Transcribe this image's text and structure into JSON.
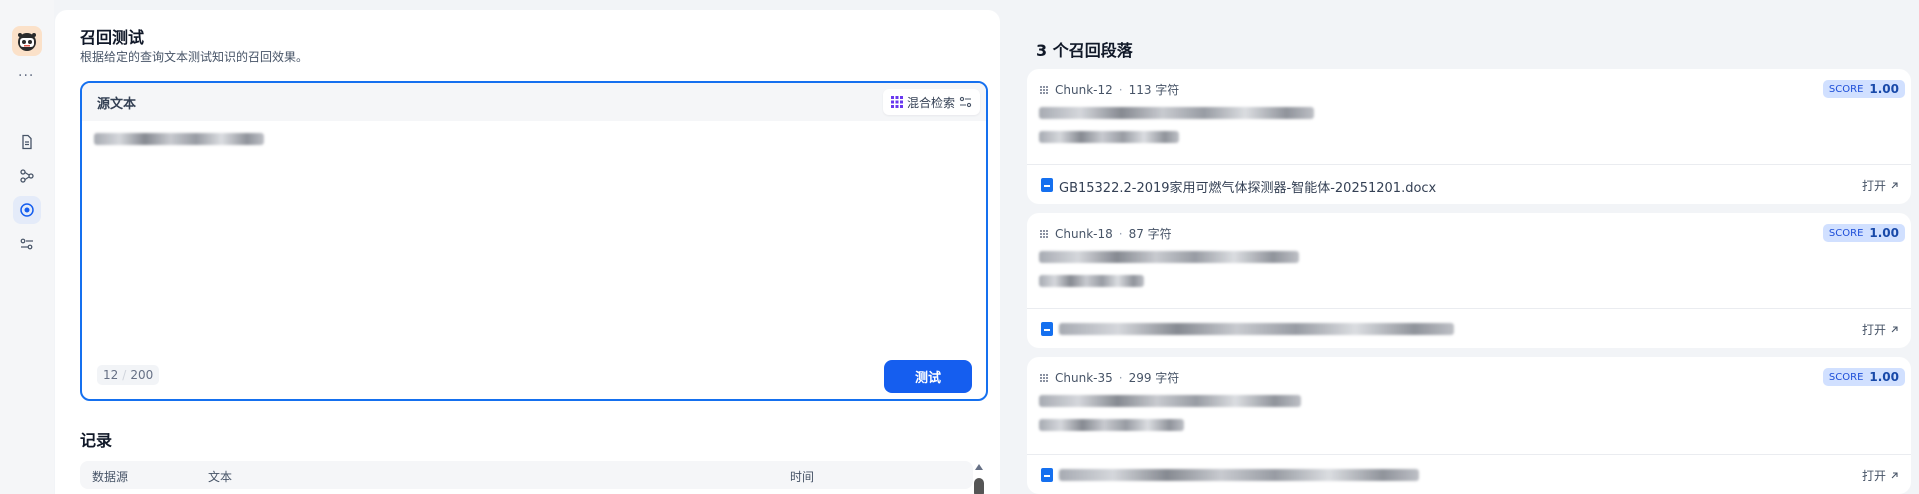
{
  "sidebar": {
    "more_label": "···",
    "items": [
      {
        "icon": "document-icon",
        "active": false
      },
      {
        "icon": "workflow-icon",
        "active": false
      },
      {
        "icon": "target-icon",
        "active": true
      },
      {
        "icon": "settings-sliders-icon",
        "active": false
      }
    ]
  },
  "header": {
    "title": "召回测试",
    "description": "根据给定的查询文本测试知识的召回效果。"
  },
  "query": {
    "label": "源文本",
    "mode_label": "混合检索",
    "char_count": "12",
    "char_limit": "200",
    "submit_label": "测试"
  },
  "records": {
    "title": "记录",
    "columns": [
      "数据源",
      "文本",
      "时间"
    ]
  },
  "results": {
    "title": "3 个召回段落",
    "score_label": "SCORE",
    "open_label": "打开",
    "chunks": [
      {
        "id": "Chunk-12",
        "chars": "113 字符",
        "score": "1.00",
        "file": "GB15322.2-2019家用可燃气体探测器-智能体-20251201.docx"
      },
      {
        "id": "Chunk-18",
        "chars": "87 字符",
        "score": "1.00",
        "file": ""
      },
      {
        "id": "Chunk-35",
        "chars": "299 字符",
        "score": "1.00",
        "file": ""
      }
    ]
  },
  "colors": {
    "accent": "#155eef",
    "focus_border": "#1570ef",
    "score_bg": "#d1e0ff"
  }
}
